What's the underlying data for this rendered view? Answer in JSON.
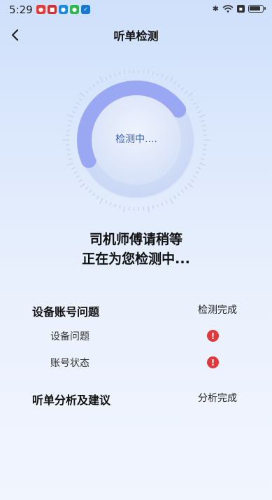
{
  "status_bar": {
    "time": "5:29"
  },
  "nav": {
    "title": "听单检测"
  },
  "gauge": {
    "label": "检测中....",
    "progress": 0.3
  },
  "wait": {
    "line1": "司机师傅请稍等",
    "line2": "正在为您检测中..."
  },
  "sections": {
    "device": {
      "title": "设备账号问题",
      "status": "检测完成",
      "items": [
        {
          "label": "设备问题",
          "icon": "alert-icon"
        },
        {
          "label": "账号状态",
          "icon": "alert-icon"
        }
      ]
    },
    "analysis": {
      "title": "听单分析及建议",
      "status": "分析完成"
    }
  },
  "colors": {
    "alert": "#e0393b",
    "accent": "#3a5fb5"
  }
}
